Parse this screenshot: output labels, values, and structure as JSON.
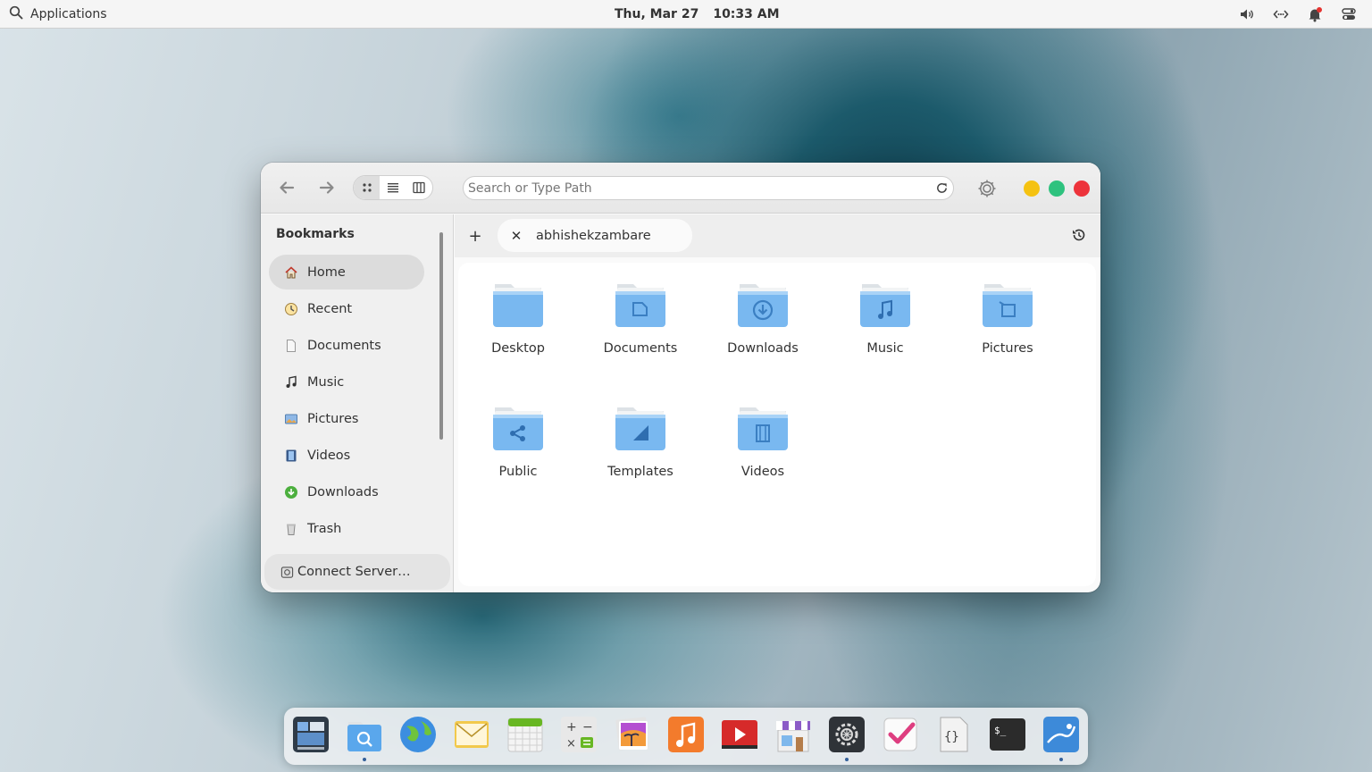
{
  "panel": {
    "applications_label": "Applications",
    "date": "Thu, Mar 27",
    "time": "10:33 AM",
    "indicators": [
      "volume-icon",
      "network-icon",
      "notifications-icon",
      "session-icon"
    ]
  },
  "window": {
    "path_placeholder": "Search or Type Path",
    "view_modes": [
      "grid",
      "list",
      "columns"
    ],
    "active_view": "grid",
    "controls": {
      "minimize": "#f5c211",
      "maximize": "#2ec27e",
      "close": "#ed333b"
    }
  },
  "sidebar": {
    "title": "Bookmarks",
    "items": [
      {
        "label": "Home",
        "icon": "home-icon"
      },
      {
        "label": "Recent",
        "icon": "recent-icon"
      },
      {
        "label": "Documents",
        "icon": "document-icon"
      },
      {
        "label": "Music",
        "icon": "music-icon"
      },
      {
        "label": "Pictures",
        "icon": "pictures-icon"
      },
      {
        "label": "Videos",
        "icon": "videos-icon"
      },
      {
        "label": "Downloads",
        "icon": "downloads-icon"
      },
      {
        "label": "Trash",
        "icon": "trash-icon"
      }
    ],
    "active_item": "Home",
    "connect_label": "Connect Server…"
  },
  "tabs": [
    {
      "label": "abhishekzambare"
    }
  ],
  "folders": [
    {
      "label": "Desktop",
      "icon": "folder-desktop-icon"
    },
    {
      "label": "Documents",
      "icon": "folder-documents-icon"
    },
    {
      "label": "Downloads",
      "icon": "folder-downloads-icon"
    },
    {
      "label": "Music",
      "icon": "folder-music-icon"
    },
    {
      "label": "Pictures",
      "icon": "folder-pictures-icon"
    },
    {
      "label": "Public",
      "icon": "folder-public-icon"
    },
    {
      "label": "Templates",
      "icon": "folder-templates-icon"
    },
    {
      "label": "Videos",
      "icon": "folder-videos-icon"
    }
  ],
  "dock": [
    {
      "app": "multitasking-view-icon",
      "running": false
    },
    {
      "app": "files-icon",
      "running": true
    },
    {
      "app": "web-browser-icon",
      "running": false
    },
    {
      "app": "mail-icon",
      "running": false
    },
    {
      "app": "calendar-icon",
      "running": false
    },
    {
      "app": "calculator-icon",
      "running": false
    },
    {
      "app": "photos-icon",
      "running": false
    },
    {
      "app": "music-app-icon",
      "running": false
    },
    {
      "app": "videos-app-icon",
      "running": false
    },
    {
      "app": "appcenter-icon",
      "running": false
    },
    {
      "app": "system-settings-icon",
      "running": true
    },
    {
      "app": "tasks-icon",
      "running": false
    },
    {
      "app": "code-icon",
      "running": false
    },
    {
      "app": "terminal-icon",
      "running": false
    },
    {
      "app": "screenshot-icon",
      "running": true
    }
  ]
}
